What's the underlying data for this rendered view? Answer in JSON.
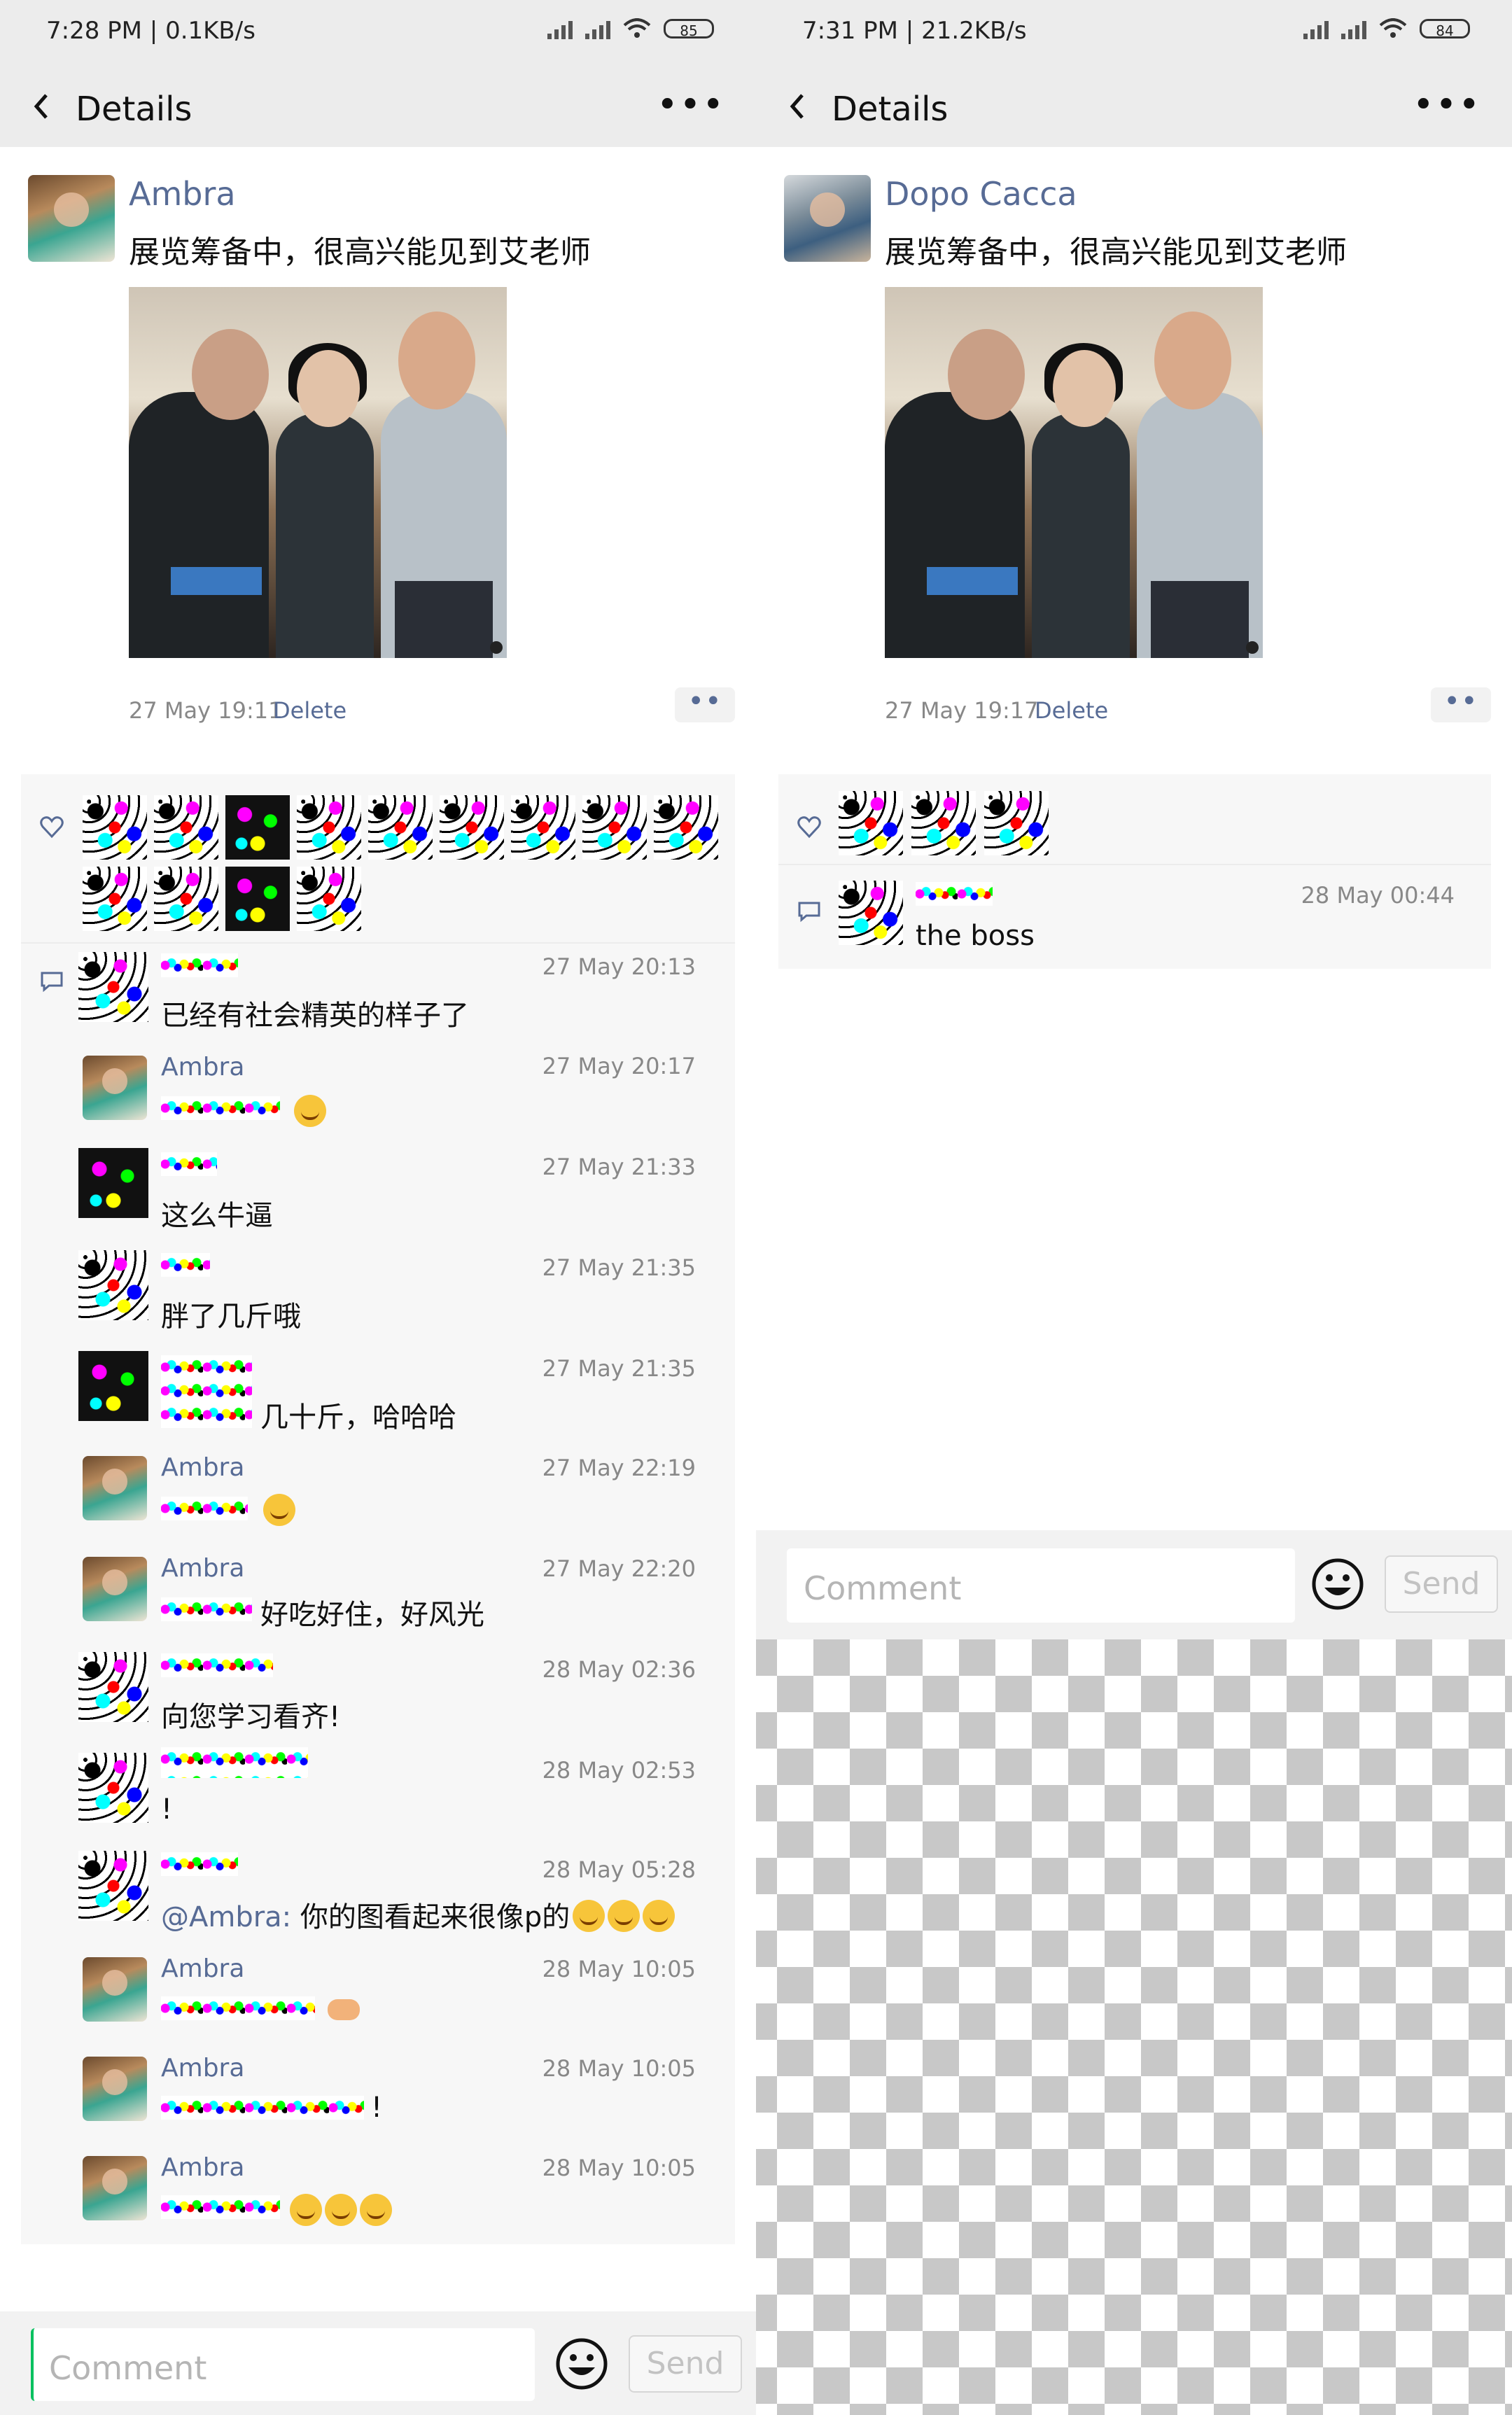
{
  "left": {
    "status": {
      "text": "7:28 PM | 0.1KB/s",
      "battery": "85"
    },
    "nav": {
      "title": "Details"
    },
    "post": {
      "author": "Ambra",
      "text": "展览筹备中，很高兴能见到艾老师",
      "time": "27 May 19:11",
      "delete_label": "Delete"
    },
    "comments": [
      {
        "name": "",
        "time": "27 May 20:13",
        "text": "已经有社会精英的样子了"
      },
      {
        "name": "Ambra",
        "time": "27 May 20:17",
        "text": ""
      },
      {
        "name": "",
        "time": "27 May 21:33",
        "text": "这么牛逼"
      },
      {
        "name": "",
        "time": "27 May 21:35",
        "text": "胖了几斤哦"
      },
      {
        "name": "",
        "time": "27 May 21:35",
        "text": "几十斤，哈哈哈"
      },
      {
        "name": "Ambra",
        "time": "27 May 22:19",
        "text": ""
      },
      {
        "name": "Ambra",
        "time": "27 May 22:20",
        "text": "好吃好住，好风光"
      },
      {
        "name": "",
        "time": "28 May 02:36",
        "text": "向您学习看齐!"
      },
      {
        "name": "",
        "time": "28 May 02:53",
        "text": "!"
      },
      {
        "name": "",
        "time": "28 May 05:28",
        "mention": "@Ambra:",
        "text": " 你的图看起来很像p的"
      },
      {
        "name": "Ambra",
        "time": "28 May 10:05",
        "text": ""
      },
      {
        "name": "Ambra",
        "time": "28 May 10:05",
        "text": "!"
      },
      {
        "name": "Ambra",
        "time": "28 May 10:05",
        "text": ""
      }
    ],
    "input": {
      "placeholder": "Comment",
      "send_label": "Send"
    }
  },
  "right": {
    "status": {
      "text": "7:31 PM | 21.2KB/s",
      "battery": "84"
    },
    "nav": {
      "title": "Details"
    },
    "post": {
      "author": "Dopo Cacca",
      "text": "展览筹备中，很高兴能见到艾老师",
      "time": "27 May 19:17",
      "delete_label": "Delete"
    },
    "comments": [
      {
        "name": "",
        "time": "28 May 00:44",
        "text": "the boss"
      }
    ],
    "input": {
      "placeholder": "Comment",
      "send_label": "Send"
    }
  },
  "colors": {
    "link": "#576b95",
    "background": "#ececec",
    "card": "#f7f7f7"
  },
  "icons": [
    "back-icon",
    "more-icon",
    "heart-icon",
    "comment-icon",
    "emoji-icon",
    "wifi-icon",
    "signal-icon",
    "battery-icon",
    "alarm-icon",
    "mute-icon"
  ]
}
